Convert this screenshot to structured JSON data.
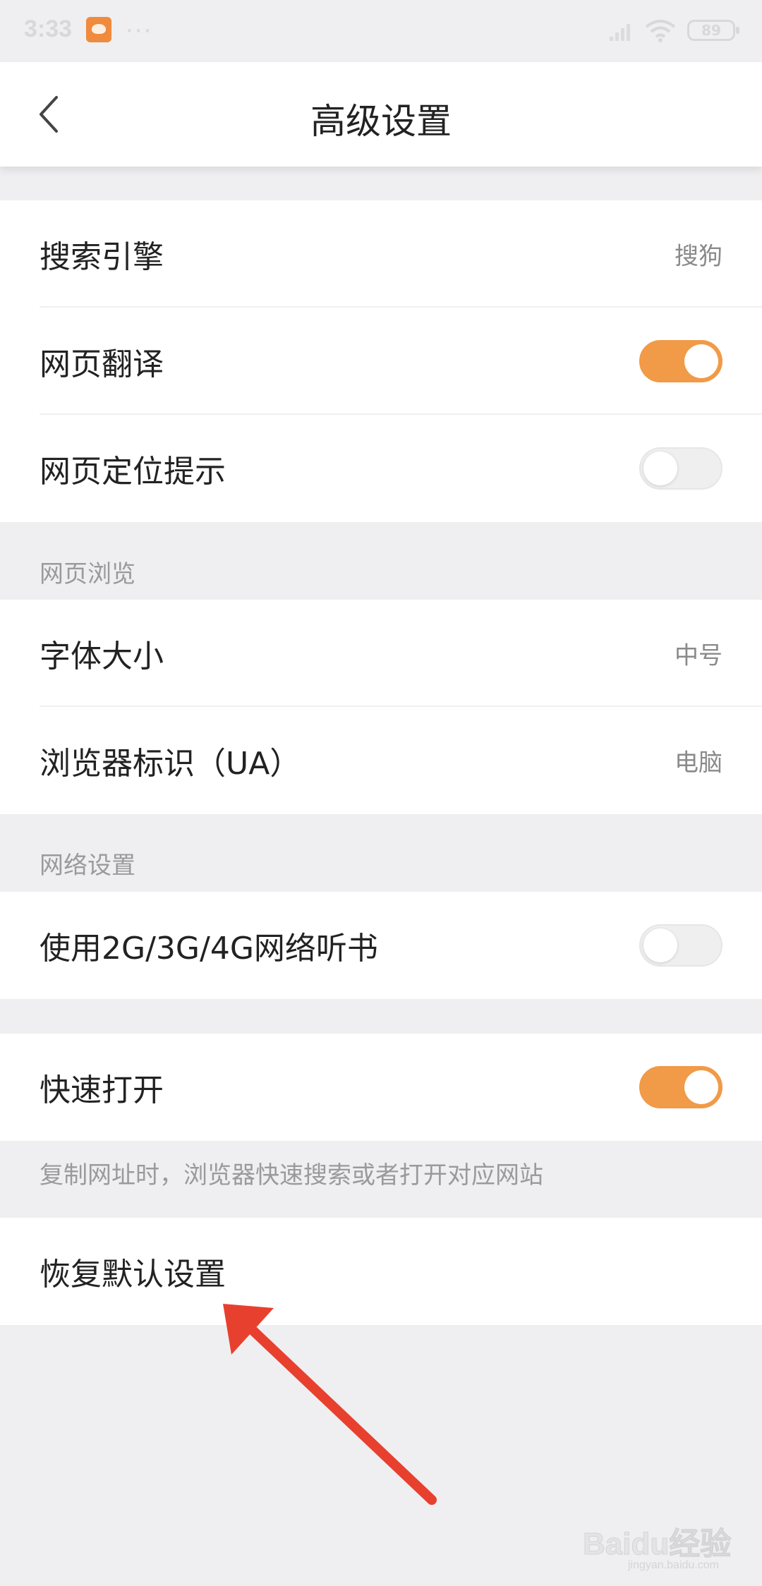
{
  "status_bar": {
    "time": "3:33",
    "dots": "···",
    "battery": "89"
  },
  "header": {
    "title": "高级设置"
  },
  "group1": {
    "search_engine": {
      "label": "搜索引擎",
      "value": "搜狗"
    },
    "translate": {
      "label": "网页翻译",
      "enabled": true
    },
    "location_prompt": {
      "label": "网页定位提示",
      "enabled": false
    }
  },
  "browsing": {
    "section_title": "网页浏览",
    "font_size": {
      "label": "字体大小",
      "value": "中号"
    },
    "user_agent": {
      "label": "浏览器标识（UA）",
      "value": "电脑"
    }
  },
  "network": {
    "section_title": "网络设置",
    "mobile_audiobook": {
      "label": "使用2G/3G/4G网络听书",
      "enabled": false
    }
  },
  "quick_open": {
    "label": "快速打开",
    "enabled": true,
    "hint": "复制网址时，浏览器快速搜索或者打开对应网站"
  },
  "reset": {
    "label": "恢复默认设置"
  },
  "watermark": {
    "text": "Baidu经验",
    "sub": "jingyan.baidu.com"
  },
  "colors": {
    "accent": "#f19a47",
    "annotation_arrow": "#e8402e",
    "background": "#efeff1"
  }
}
